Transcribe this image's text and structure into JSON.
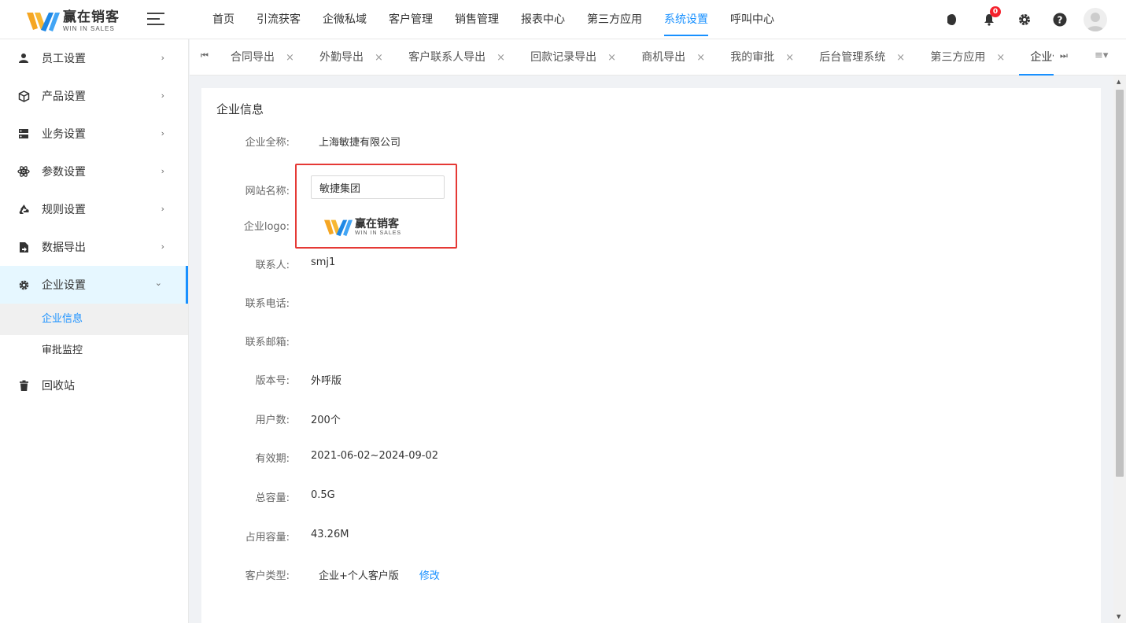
{
  "app": {
    "logo_cn": "赢在销客",
    "logo_en": "WIN IN SALES"
  },
  "topnav": {
    "items": [
      "首页",
      "引流获客",
      "企微私域",
      "客户管理",
      "销售管理",
      "报表中心",
      "第三方应用",
      "系统设置",
      "呼叫中心"
    ],
    "active_index": 7
  },
  "header_icons": {
    "notification_count": "0",
    "icons": [
      "moon-icon",
      "bell-icon",
      "gear-icon",
      "help-icon",
      "avatar"
    ]
  },
  "sidebar": {
    "items": [
      {
        "label": "员工设置",
        "icon": "user-icon"
      },
      {
        "label": "产品设置",
        "icon": "cube-icon"
      },
      {
        "label": "业务设置",
        "icon": "server-icon"
      },
      {
        "label": "参数设置",
        "icon": "atom-icon"
      },
      {
        "label": "规则设置",
        "icon": "recycle-icon"
      },
      {
        "label": "数据导出",
        "icon": "file-export-icon"
      },
      {
        "label": "企业设置",
        "icon": "gear-icon"
      }
    ],
    "submenu": [
      "企业信息",
      "审批监控"
    ],
    "trash": {
      "label": "回收站",
      "icon": "trash-icon"
    }
  },
  "tabs": {
    "items": [
      "合同导出",
      "外勤导出",
      "客户联系人导出",
      "回款记录导出",
      "商机导出",
      "我的审批",
      "后台管理系统",
      "第三方应用",
      "企业信息"
    ],
    "active_index": 8
  },
  "company_info": {
    "title": "企业信息",
    "full_name_label": "企业全称:",
    "full_name": "上海敏捷有限公司",
    "site_name_label": "网站名称:",
    "site_name": "敏捷集团",
    "logo_label": "企业logo:",
    "contact_label": "联系人:",
    "contact": "smj1",
    "phone_label": "联系电话:",
    "phone": "",
    "email_label": "联系邮箱:",
    "email": "",
    "version_label": "版本号:",
    "version": "外呼版",
    "users_label": "用户数:",
    "users": "200个",
    "validity_label": "有效期:",
    "validity": "2021-06-02~2024-09-02",
    "capacity_label": "总容量:",
    "capacity": "0.5G",
    "used_label": "占用容量:",
    "used": "43.26M",
    "customer_type_label": "客户类型:",
    "customer_type": "企业+个人客户版",
    "edit_label": "修改"
  },
  "colors": {
    "accent": "#1890ff",
    "highlight_border": "#e53935",
    "logo_orange": "#f5a623",
    "logo_blue": "#1e88e5"
  }
}
